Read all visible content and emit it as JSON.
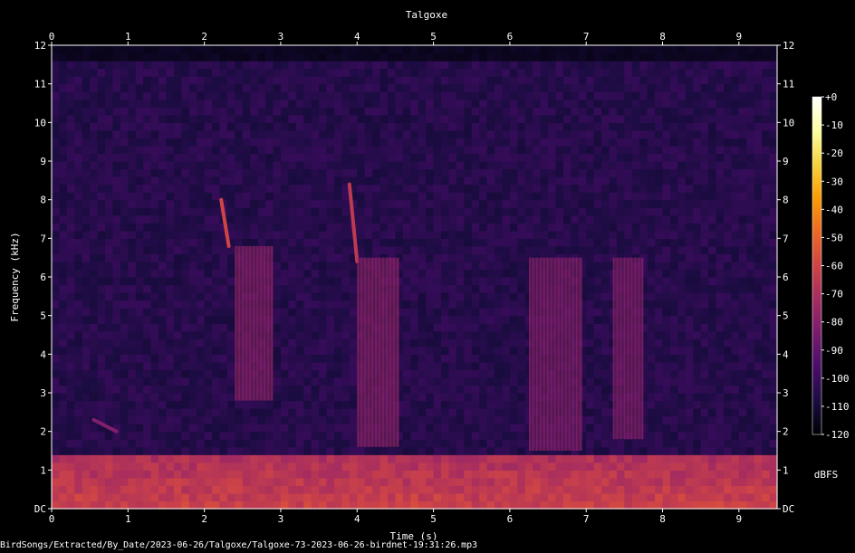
{
  "chart_data": {
    "type": "heatmap",
    "title": "Talgoxe",
    "xlabel": "Time (s)",
    "ylabel": "Frequency (kHz)",
    "xlim": [
      0,
      9.5
    ],
    "ylim": [
      0,
      12
    ],
    "x_ticks": [
      "0",
      "1",
      "2",
      "3",
      "4",
      "5",
      "6",
      "7",
      "8",
      "9"
    ],
    "y_ticks": [
      "DC",
      "1",
      "2",
      "3",
      "4",
      "5",
      "6",
      "7",
      "8",
      "9",
      "10",
      "11",
      "12"
    ],
    "colorbar": {
      "label": "dBFS",
      "range": [
        -120,
        0
      ],
      "ticks": [
        "+0",
        "-10",
        "-20",
        "-30",
        "-40",
        "-50",
        "-60",
        "-70",
        "-80",
        "-90",
        "-100",
        "-110",
        "-120"
      ],
      "colormap": [
        "#000004",
        "#1b0c41",
        "#4a0c6b",
        "#781c6d",
        "#a52c60",
        "#cf4446",
        "#ed6925",
        "#fb9b06",
        "#f7d13d",
        "#fcffa4",
        "#ffffff"
      ]
    },
    "grid": false,
    "background_level_db": -105,
    "band_limit_khz": 11.5,
    "events": [
      {
        "type": "chirp",
        "t_start": 2.22,
        "t_end": 2.32,
        "f_start": 8.0,
        "f_end": 6.8,
        "level_db": -60
      },
      {
        "type": "buzz",
        "t_start": 2.4,
        "t_end": 2.9,
        "f_low": 2.8,
        "f_high": 6.8,
        "level_db": -80
      },
      {
        "type": "chirp",
        "t_start": 3.9,
        "t_end": 4.0,
        "f_start": 8.4,
        "f_end": 6.4,
        "level_db": -65
      },
      {
        "type": "buzz",
        "t_start": 4.0,
        "t_end": 4.55,
        "f_low": 1.6,
        "f_high": 6.5,
        "level_db": -80
      },
      {
        "type": "buzz",
        "t_start": 6.25,
        "t_end": 6.95,
        "f_low": 1.5,
        "f_high": 6.5,
        "level_db": -82
      },
      {
        "type": "buzz",
        "t_start": 7.35,
        "t_end": 7.75,
        "f_low": 1.8,
        "f_high": 6.5,
        "level_db": -82
      },
      {
        "type": "chirp",
        "t_start": 0.55,
        "t_end": 0.85,
        "f_start": 2.3,
        "f_end": 2.0,
        "level_db": -82
      }
    ],
    "low_frequency_noise": {
      "f_high": 1.3,
      "level_db": -70
    }
  },
  "caption": "BirdSongs/Extracted/By_Date/2023-06-26/Talgoxe/Talgoxe-73-2023-06-26-birdnet-19:31:26.mp3"
}
